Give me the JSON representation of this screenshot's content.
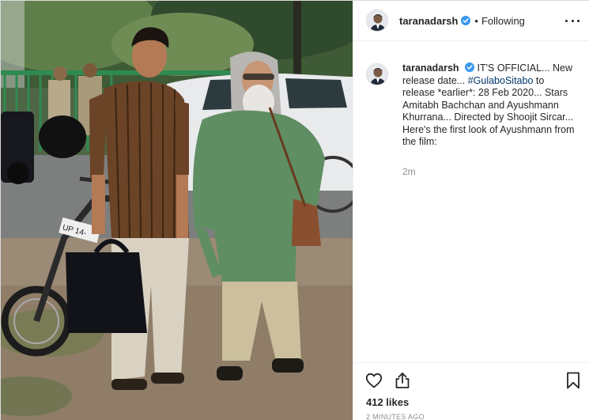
{
  "post": {
    "photo": {
      "alt_subject": "film still",
      "plate_text": "UP 14-"
    },
    "header": {
      "username": "taranadarsh",
      "separator": "•",
      "follow_status": "Following",
      "verified": true
    },
    "caption": {
      "username": "taranadarsh",
      "text_before_tag": "IT'S OFFICIAL... New release date... ",
      "hashtag": "#GulaboSitabo",
      "text_after_tag": " to release *earlier*: 28 Feb 2020... Stars Amitabh Bachchan and Ayushmann Khurrana... Directed by Shoojit Sircar... Here's the first look of Ayushmann from the film:",
      "time": "2m"
    },
    "footer": {
      "likes": "412 likes",
      "posted_ago": "2 MINUTES AGO"
    },
    "colors": {
      "verified_blue": "#3897f0",
      "hashtag": "#003569",
      "muted_text": "#8e8e8e",
      "border": "#efefef"
    },
    "icons": [
      "verified-badge-icon",
      "more-options-icon",
      "heart-icon",
      "share-icon",
      "bookmark-icon"
    ]
  }
}
